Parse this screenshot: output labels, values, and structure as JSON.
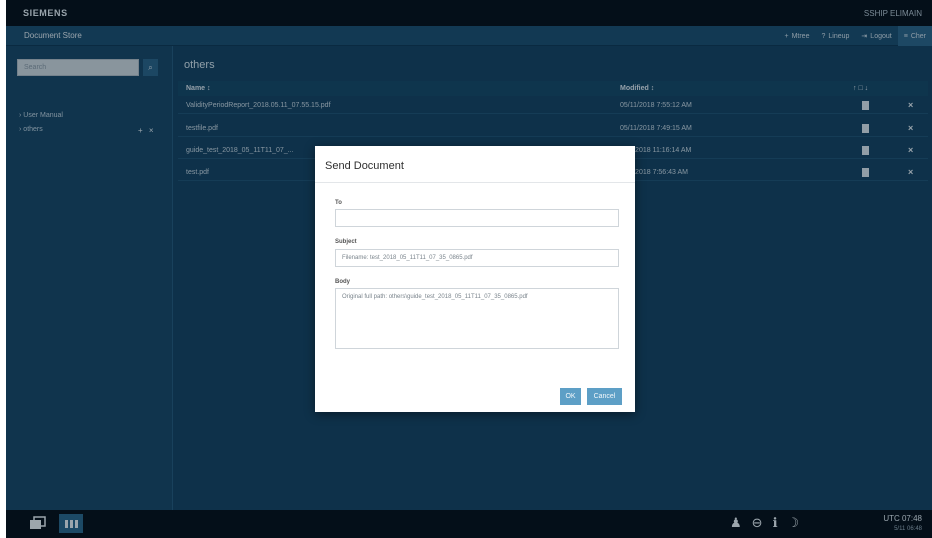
{
  "topbar": {
    "brand": "SIEMENS",
    "user": "SSHIP ELIMAIN"
  },
  "header": {
    "title": "Document Store",
    "links": [
      {
        "icon": "+",
        "label": "Mtree"
      },
      {
        "icon": "?",
        "label": "Lineup"
      },
      {
        "icon": "⇥",
        "label": "Logout"
      },
      {
        "icon": "≡",
        "label": "Cher"
      }
    ]
  },
  "sidebar": {
    "search_placeholder": "Search",
    "search_button": "⌕",
    "items": [
      {
        "label": "User Manual"
      },
      {
        "label": "others"
      }
    ],
    "item_actions": "+ ×"
  },
  "main": {
    "folder": "others",
    "columns": {
      "name": "Name ↕",
      "modified": "Modified ↕",
      "icons": "↑ □ ↓"
    },
    "rows": [
      {
        "name": "ValidityPeriodReport_2018.05.11_07.55.15.pdf",
        "modified": "05/11/2018 7:55:12 AM",
        "delete": "×"
      },
      {
        "name": "testfile.pdf",
        "modified": "05/11/2018 7:49:15 AM",
        "delete": "×"
      },
      {
        "name": "guide_test_2018_05_11T11_07_...",
        "modified": "5/11/2018 11:16:14 AM",
        "delete": "×"
      },
      {
        "name": "test.pdf",
        "modified": "5/11/2018 7:56:43 AM",
        "delete": "×"
      }
    ]
  },
  "modal": {
    "title": "Send Document",
    "to_label": "To",
    "to_value": "",
    "subject_label": "Subject",
    "subject_value": "Filename: test_2018_05_11T11_07_35_0865.pdf",
    "body_label": "Body",
    "body_value": "Original full path: others\\guide_test_2018_05_11T11_07_35_0865.pdf",
    "ok_label": "OK",
    "cancel_label": "Cancel"
  },
  "taskbar": {
    "status_icons": [
      "♟",
      "⊖",
      "ℹ",
      "☽"
    ],
    "time": "UTC 07:48",
    "date": "5/11 06:48"
  }
}
